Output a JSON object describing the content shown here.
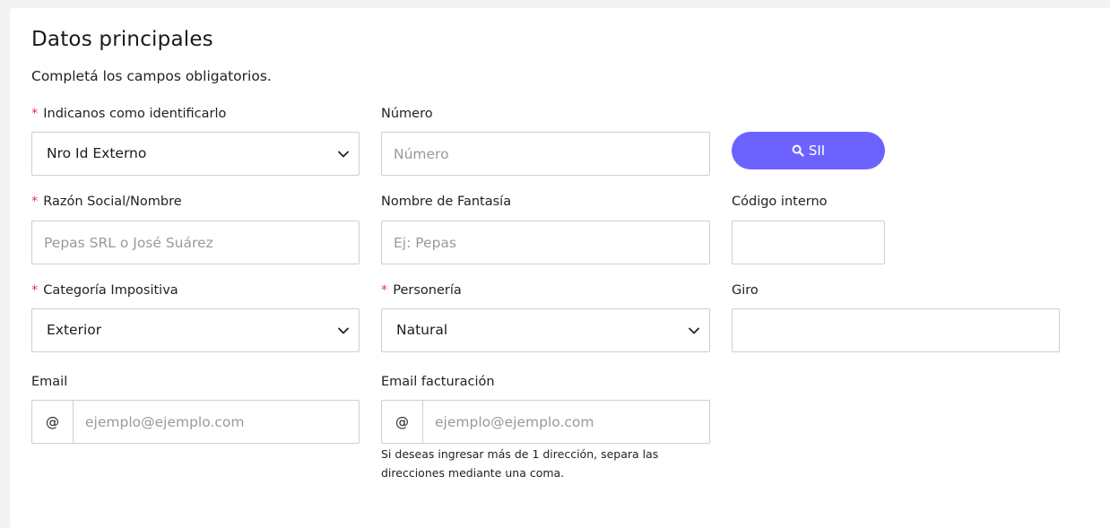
{
  "section": {
    "title": "Datos principales",
    "subtitle": "Completá los campos obligatorios."
  },
  "fields": {
    "identifier": {
      "label": "Indicanos como identificarlo",
      "required": true,
      "value": "Nro Id Externo"
    },
    "number": {
      "label": "Número",
      "placeholder": "Número",
      "value": ""
    },
    "sii_button": {
      "label": "SII",
      "icon": "search-icon",
      "color": "#6c63ff"
    },
    "business_name": {
      "label": "Razón Social/Nombre",
      "required": true,
      "placeholder": "Pepas SRL o José Suárez",
      "value": ""
    },
    "trade_name": {
      "label": "Nombre de Fantasía",
      "placeholder": "Ej: Pepas",
      "value": ""
    },
    "internal_code": {
      "label": "Código interno",
      "value": ""
    },
    "tax_category": {
      "label": "Categoría Impositiva",
      "required": true,
      "value": "Exterior"
    },
    "person_type": {
      "label": "Personería",
      "required": true,
      "value": "Natural"
    },
    "giro": {
      "label": "Giro",
      "value": ""
    },
    "email": {
      "label": "Email",
      "addon": "@",
      "placeholder": "ejemplo@ejemplo.com",
      "value": ""
    },
    "billing_email": {
      "label": "Email facturación",
      "addon": "@",
      "placeholder": "ejemplo@ejemplo.com",
      "value": "",
      "hint": "Si deseas ingresar más de 1 dirección, separa las direcciones mediante una coma."
    }
  },
  "colors": {
    "required_marker": "#e0345a",
    "primary": "#6c63ff"
  }
}
